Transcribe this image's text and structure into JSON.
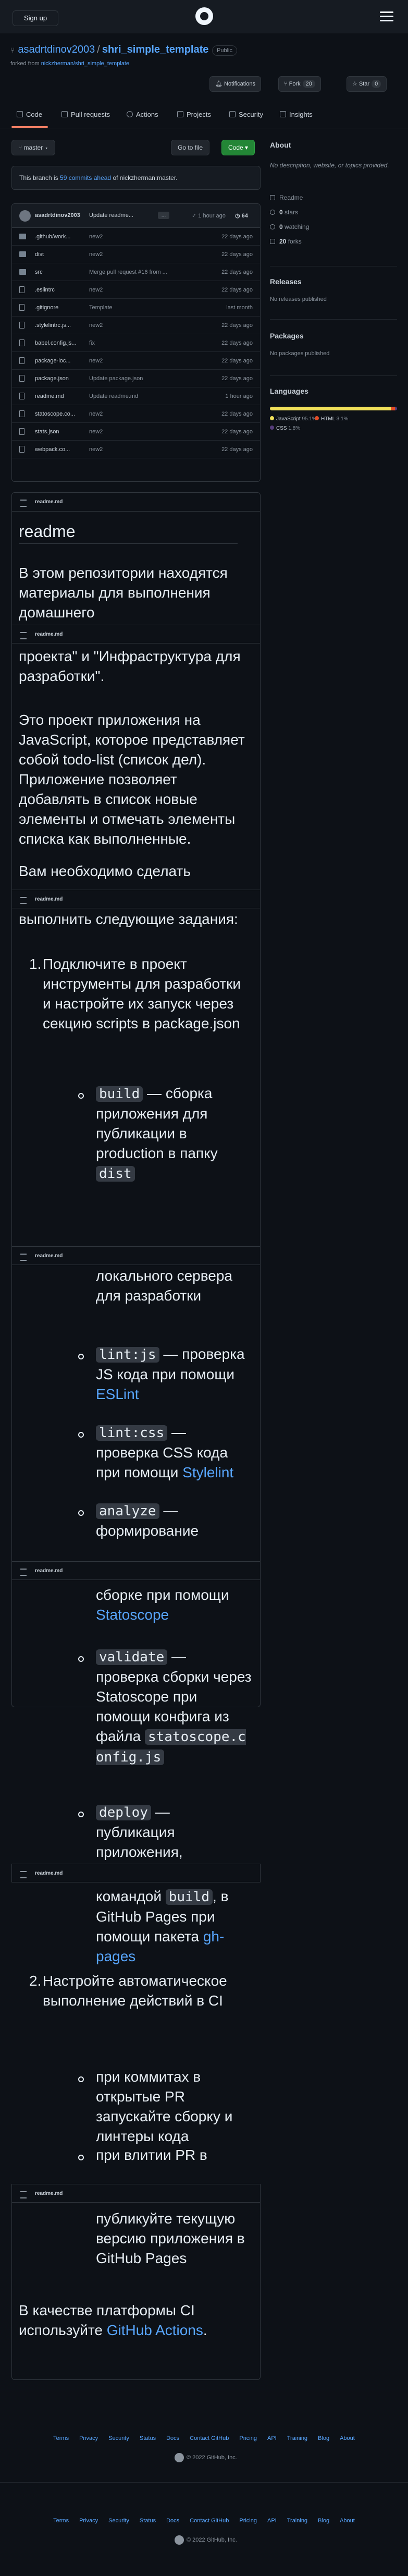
{
  "header": {
    "signup": "Sign up"
  },
  "repo": {
    "owner": "asadrtdinov2003",
    "name": "shri_simple_template",
    "visibility": "Public",
    "forked_prefix": "forked from",
    "forked_from": "nickzherman/shri_simple_template"
  },
  "actions": {
    "notifications": "Notifications",
    "fork": "Fork",
    "fork_count": "20",
    "star": "Star",
    "star_count": "0"
  },
  "tabs": [
    "Code",
    "Pull requests",
    "Actions",
    "Projects",
    "Security",
    "Insights"
  ],
  "branch": {
    "name": "master",
    "goto_file": "Go to file",
    "code": "Code",
    "status_prefix": "This branch is",
    "status_link": "59 commits ahead",
    "status_suffix": "of nickzherman:master."
  },
  "commit": {
    "author": "asadrtdinov2003",
    "message": "Update readme...",
    "dots": "…",
    "time": "1 hour ago",
    "count": "64"
  },
  "files": [
    {
      "name": ".github/work...",
      "msg": "new2",
      "age": "22 days ago",
      "type": "dir"
    },
    {
      "name": "dist",
      "msg": "new2",
      "age": "22 days ago",
      "type": "dir"
    },
    {
      "name": "src",
      "msg": "Merge pull request #16 from ...",
      "age": "22 days ago",
      "type": "dir"
    },
    {
      "name": ".eslintrc",
      "msg": "new2",
      "age": "22 days ago",
      "type": "file"
    },
    {
      "name": ".gitignore",
      "msg": "Template",
      "age": "last month",
      "type": "file"
    },
    {
      "name": ".stylelintrc.js...",
      "msg": "new2",
      "age": "22 days ago",
      "type": "file"
    },
    {
      "name": "babel.config.js...",
      "msg": "fix",
      "age": "22 days ago",
      "type": "file"
    },
    {
      "name": "package-loc...",
      "msg": "new2",
      "age": "22 days ago",
      "type": "file"
    },
    {
      "name": "package.json",
      "msg": "Update package.json",
      "age": "22 days ago",
      "type": "file"
    },
    {
      "name": "readme.md",
      "msg": "Update readme.md",
      "age": "1 hour ago",
      "type": "file"
    },
    {
      "name": "statoscope.co...",
      "msg": "new2",
      "age": "22 days ago",
      "type": "file"
    },
    {
      "name": "stats.json",
      "msg": "new2",
      "age": "22 days ago",
      "type": "file"
    },
    {
      "name": "webpack.co...",
      "msg": "new2",
      "age": "22 days ago",
      "type": "file"
    }
  ],
  "sidebar": {
    "about_title": "About",
    "about_text": "No description, website, or topics provided.",
    "readme": "Readme",
    "stars_num": "0",
    "stars_label": "stars",
    "watching_num": "0",
    "watching_label": "watching",
    "forks_num": "20",
    "forks_label": "forks",
    "releases_title": "Releases",
    "releases_text": "No releases published",
    "packages_title": "Packages",
    "packages_text": "No packages published",
    "languages_title": "Languages",
    "languages": [
      {
        "name": "JavaScript",
        "pct": "95.1%",
        "value": 95.1,
        "color": "#f1e05a"
      },
      {
        "name": "HTML",
        "pct": "3.1%",
        "value": 3.1,
        "color": "#e34c26"
      },
      {
        "name": "CSS",
        "pct": "1.8%",
        "value": 1.8,
        "color": "#563d7c"
      }
    ]
  },
  "readme": {
    "file_label": "readme.md",
    "title": "readme",
    "intro_a": "В этом репозитории находятся материалы для выполнения домашнего",
    "intro_b": "проекта\" и \"Инфраструктура для разработки\".",
    "about_app": "Это проект приложения на JavaScript, которое представляет собой todo-list (список дел). Приложение позволяет добавлять в список новые элементы и отмечать элементы списка как выполненные.",
    "need_a": "Вам необходимо сделать",
    "need_b": "выполнить следующие задания:",
    "item1": "Подключите в проект инструменты для разработки и настройте их запуск через секцию scripts в package.json",
    "build_code": "build",
    "build_text_a": " — сборка приложения для публикации в production в папку",
    "dist_code": "dist",
    "local_server": "локального сервера для разработки",
    "lintjs_code": "lint:js",
    "lintjs_text": " — проверка JS кода при помощи ",
    "eslint": "ESLint",
    "lintcss_code": "lint:css",
    "lintcss_text": " — проверка CSS кода при помощи ",
    "stylelint": "Stylelint",
    "analyze_code": "analyze",
    "analyze_text": " — формирование",
    "statoscope_a": "сборке при помощи ",
    "statoscope": "Statoscope",
    "validate_code": "validate",
    "validate_text": " — проверка сборки через Statoscope при помощи конфига из файла ",
    "statoscope_cfg": "statoscope.config.js",
    "deploy_code": "deploy",
    "deploy_text": " — публикация приложения,",
    "gh_pages_a": ", в GitHub Pages при помощи пакета ",
    "gh_pages": "gh-pages",
    "build_code2": "build",
    "cmd_prefix": "командой ",
    "item2": "Настройте автоматическое выполнение действий в CI",
    "ci1": "при коммитах в открытые PR запускайте сборку и линтеры кода",
    "ci2": "при влитии PR в",
    "publish": "публикуйте текущую версию приложения в GitHub Pages",
    "platform_a": "В качестве платформы CI используйте ",
    "gh_actions": "GitHub Actions",
    "platform_end": "."
  },
  "footer": {
    "links": [
      "Terms",
      "Privacy",
      "Security",
      "Status",
      "Docs",
      "Contact GitHub",
      "Pricing",
      "API",
      "Training",
      "Blog",
      "About"
    ],
    "copyright": "© 2022 GitHub, Inc."
  }
}
